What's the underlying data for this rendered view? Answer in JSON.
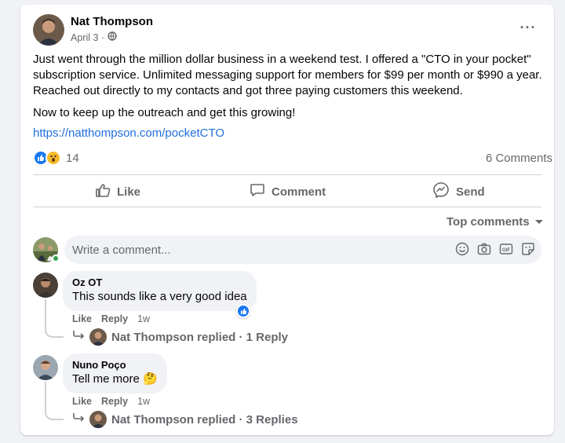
{
  "post": {
    "author": "Nat Thompson",
    "date": "April 3 ·",
    "privacy_icon": "globe-icon",
    "paragraphs": [
      "Just went through the million dollar business in a weekend test.  I offered a \"CTO in your pocket\" subscription service.  Unlimited messaging support for members for $99 per month or $990 a year.  Reached out directly to my contacts and got three paying customers this weekend.",
      "Now to keep up the outreach and get this growing!"
    ],
    "link": "https://natthompson.com/pocketCTO",
    "reaction_count": "14",
    "comments_count": "6 Comments"
  },
  "actions": {
    "like": "Like",
    "comment": "Comment",
    "send": "Send"
  },
  "sort_label": "Top comments",
  "composer": {
    "placeholder": "Write a comment..."
  },
  "comments": [
    {
      "author": "Oz OT",
      "text": "This sounds like a very good idea",
      "like": "Like",
      "reply": "Reply",
      "time": "1w",
      "replies_label": "Nat Thompson replied · 1 Reply"
    },
    {
      "author": "Nuno Poço",
      "text": "Tell me more 🤔",
      "like": "Like",
      "reply": "Reply",
      "time": "1w",
      "replies_label": "Nat Thompson replied · 3 Replies"
    }
  ],
  "colors": {
    "link": "#216fdb",
    "like_blue": "#1877f2",
    "muted": "#65676b",
    "bubble_bg": "#f0f2f5",
    "online": "#31a24c"
  }
}
